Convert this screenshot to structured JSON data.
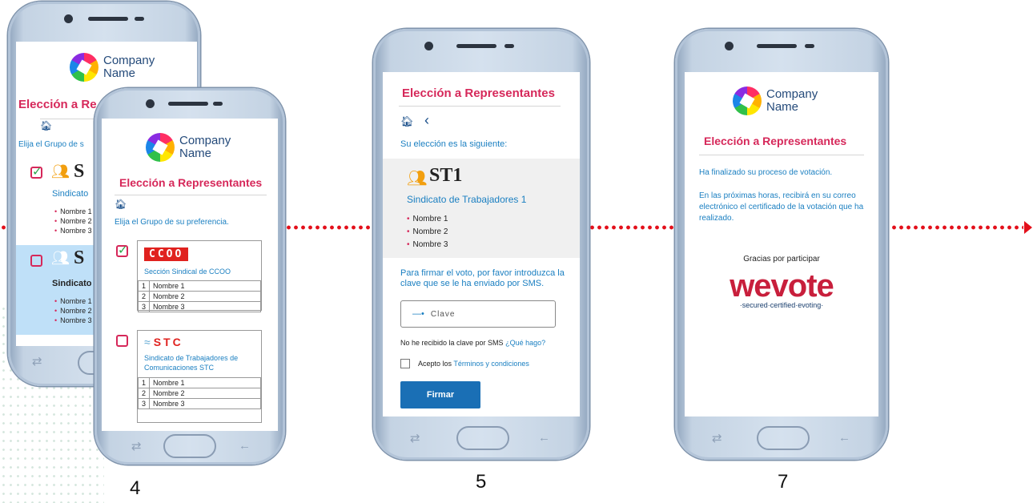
{
  "steps": {
    "s4": "4",
    "s5": "5",
    "s7": "7"
  },
  "brand": {
    "company_line1": "Company",
    "company_line2": "Name"
  },
  "title": "Elección a Representantes",
  "phone4_back": {
    "title_partial": "Elección a Re",
    "instruction_partial": "Elija el Grupo de s",
    "groups": [
      {
        "short": "S",
        "name_partial": "Sindicato",
        "names": [
          "Nombre 1",
          "Nombre 2",
          "Nombre 3"
        ]
      },
      {
        "short": "S",
        "name_partial": "Sindicato",
        "names": [
          "Nombre 1",
          "Nombre 2",
          "Nombre 3"
        ]
      }
    ]
  },
  "phone4_front": {
    "instruction": "Elija el Grupo de su preferencia.",
    "ccoo": {
      "logo": "CCOO",
      "section": "Sección Sindical de CCOO",
      "rows": [
        [
          "1",
          "Nombre 1"
        ],
        [
          "2",
          "Nombre 2"
        ],
        [
          "3",
          "Nombre 3"
        ]
      ]
    },
    "stc": {
      "logo": "STC",
      "section": "Sindicato de Trabajadores de Comunicaciones STC",
      "rows": [
        [
          "1",
          "Nombre 1"
        ],
        [
          "2",
          "Nombre 2"
        ],
        [
          "3",
          "Nombre 3"
        ]
      ]
    }
  },
  "phone5": {
    "subtitle": "Su elección es la siguiente:",
    "party_short": "ST1",
    "party_name": "Sindicato de Trabajadores 1",
    "names": [
      "Nombre 1",
      "Nombre 2",
      "Nombre 3"
    ],
    "sign_instructions": "Para firmar el voto, por favor introduzca la clave que se le ha enviado por SMS.",
    "key_placeholder": "Clave",
    "no_sms": "No he recibido la clave por SMS",
    "no_sms_link": "¿Qué hago?",
    "accept_prefix": "Acepto los",
    "accept_link": "Términos y condiciones",
    "sign_button": "Firmar"
  },
  "phone7": {
    "done": "Ha finalizado su proceso de votación.",
    "email_info": "En las próximas horas, recibirá en su correo electrónico el certificado de la votación que ha realizado.",
    "thanks": "Gracias por participar",
    "wevote_logo": "wevote",
    "wevote_tagline": "·secured·certified·evoting·"
  },
  "colors": {
    "accent": "#d6285a",
    "link": "#1a7fc1",
    "flow": "#e3101b",
    "button": "#1a6fb5"
  },
  "icons": {
    "home": "home-icon",
    "back": "chevron-left-icon",
    "key": "key-icon",
    "people": "people-group-icon"
  }
}
